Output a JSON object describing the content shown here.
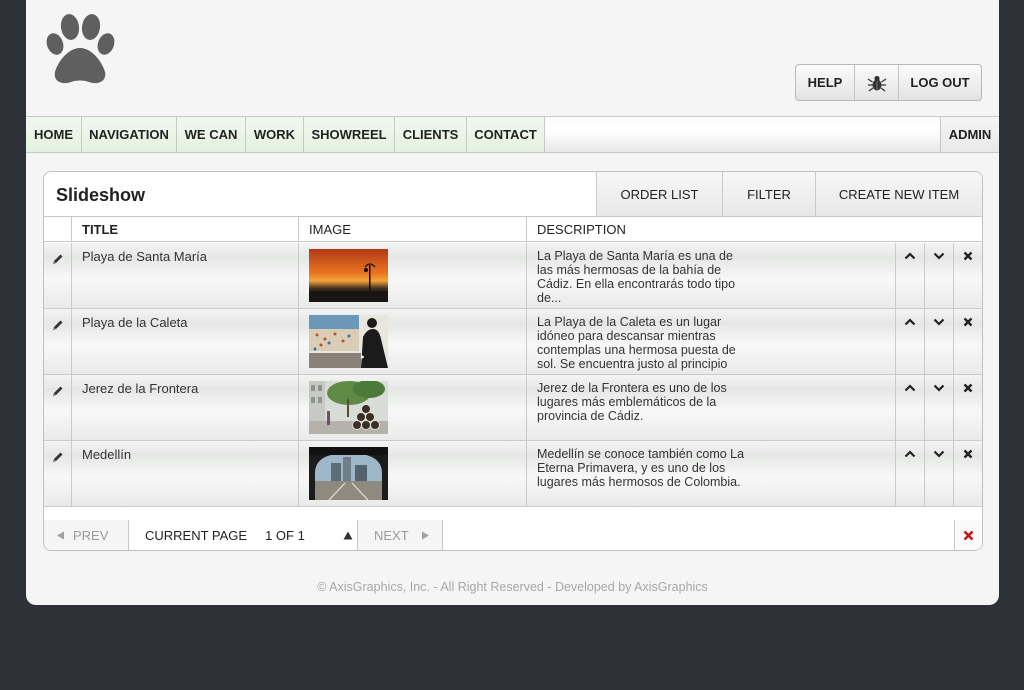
{
  "header": {
    "logo_icon": "paw-icon",
    "help_label": "HELP",
    "bug_icon": "bug-icon",
    "logout_label": "LOG OUT"
  },
  "nav": {
    "items": [
      "HOME",
      "NAVIGATION",
      "WE CAN",
      "WORK",
      "SHOWREEL",
      "CLIENTS",
      "CONTACT"
    ],
    "admin_label": "ADMIN"
  },
  "panel": {
    "title": "Slideshow",
    "actions": [
      "ORDER LIST",
      "FILTER",
      "CREATE NEW ITEM"
    ]
  },
  "table": {
    "columns": [
      "TITLE",
      "IMAGE",
      "DESCRIPTION"
    ],
    "rows": [
      {
        "title": "Playa de Santa María",
        "image_icon": "sunset-beach-photo",
        "description": "La Playa de Santa María es una de las más hermosas de la bahía de Cádiz. En ella encontrarás todo tipo de..."
      },
      {
        "title": "Playa de la Caleta",
        "image_icon": "caleta-beach-photo",
        "description": "La Playa de la Caleta es un lugar idóneo para descansar mientras contemplas una hermosa puesta de sol. Se encuentra justo al principio"
      },
      {
        "title": "Jerez de la Frontera",
        "image_icon": "jerez-street-photo",
        "description": "Jerez de la Frontera es uno de los lugares más emblemáticos de la provincia de Cádiz."
      },
      {
        "title": "Medellín",
        "image_icon": "medellin-station-photo",
        "description": "Medellín se conoce también como La Eterna Primavera, y es uno de los lugares más hermosos de Colombia."
      }
    ]
  },
  "pager": {
    "prev_label": "PREV",
    "current_page_label": "CURRENT PAGE",
    "page_value": "1 OF 1",
    "next_label": "NEXT"
  },
  "footer": {
    "copyright": "© AxisGraphics, Inc. - All Right Reserved - Developed by AxisGraphics"
  },
  "colors": {
    "background": "#2e3138",
    "nav_item": "#e4f1df",
    "delete_red": "#cc1111"
  }
}
